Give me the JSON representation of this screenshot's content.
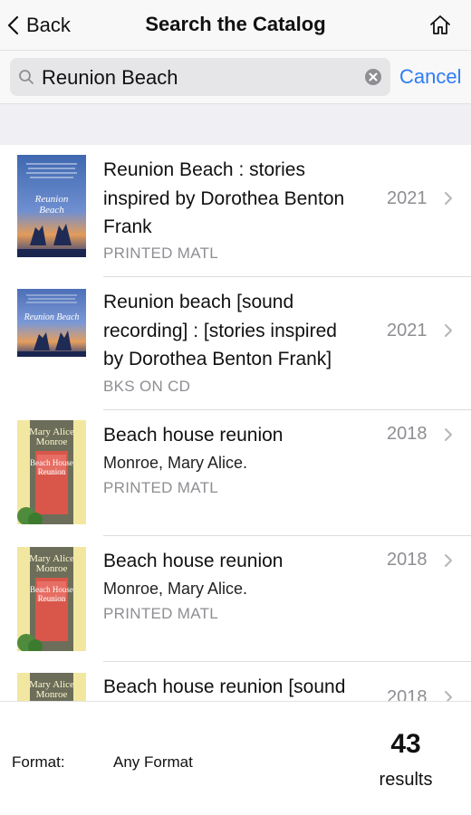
{
  "nav": {
    "back_label": "Back",
    "title": "Search the Catalog",
    "home_icon": "home-icon"
  },
  "search": {
    "value": "Reunion Beach",
    "cancel_label": "Cancel"
  },
  "results": [
    {
      "title_lines": [
        "Reunion Beach : stories",
        "inspired by Dorothea Benton",
        "Frank"
      ],
      "author": "",
      "format": "PRINTED MATL",
      "year": "2021"
    },
    {
      "title_lines": [
        "Reunion beach [sound",
        "recording] : [stories inspired",
        "by Dorothea Benton Frank]"
      ],
      "author": "",
      "format": "BKS ON CD",
      "year": "2021"
    },
    {
      "title_lines": [
        "Beach house reunion"
      ],
      "author": "Monroe, Mary Alice.",
      "format": "PRINTED MATL",
      "year": "2018"
    },
    {
      "title_lines": [
        "Beach house reunion"
      ],
      "author": "Monroe, Mary Alice.",
      "format": "PRINTED MATL",
      "year": "2018"
    },
    {
      "title_lines": [
        "Beach house reunion [sound"
      ],
      "author": "",
      "format": "",
      "year": "2018"
    }
  ],
  "footer": {
    "format_label": "Format:",
    "format_value": "Any Format",
    "count": "43",
    "results_label": "results"
  },
  "colors": {
    "accent": "#2f7cf6",
    "secondary_text": "#8e8e93",
    "section_gap": "#efeff4"
  }
}
